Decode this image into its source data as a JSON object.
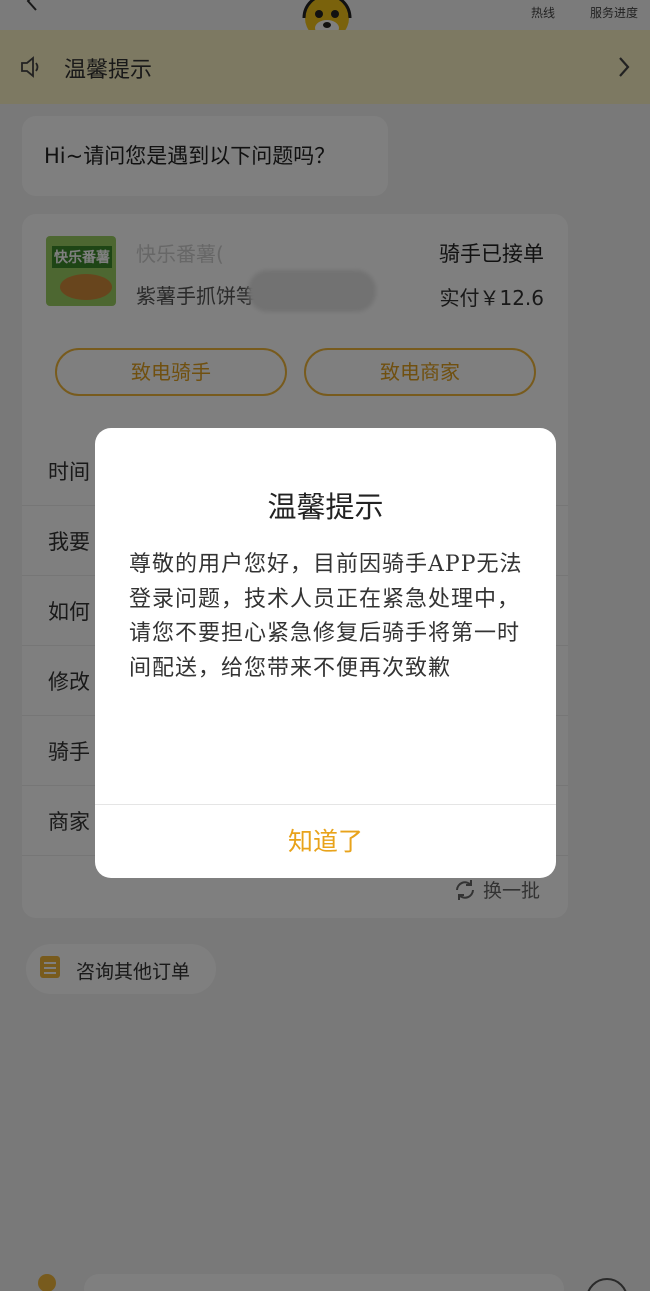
{
  "header": {
    "hotline_label": "热线",
    "progress_label": "服务进度"
  },
  "notice": {
    "text": "温馨提示"
  },
  "greeting": {
    "text": "Hi~请问您是遇到以下问题吗？"
  },
  "order": {
    "thumb_brand": "快乐番薯",
    "shop_name": "快乐番薯(",
    "item_name": "紫薯手抓饼等",
    "status": "骑手已接单",
    "price": "实付￥12.6",
    "call_rider_label": "致电骑手",
    "call_merchant_label": "致电商家"
  },
  "faq": {
    "items": [
      {
        "label": "时间"
      },
      {
        "label": "我要"
      },
      {
        "label": "如何"
      },
      {
        "label": "修改"
      },
      {
        "label": "骑手"
      },
      {
        "label": "商家"
      }
    ],
    "refresh_label": "换一批"
  },
  "other_orders": {
    "label": "咨询其他订单"
  },
  "dialog": {
    "title": "温馨提示",
    "body": "尊敬的用户您好，目前因骑手APP无法登录问题，技术人员正在紧急处理中，请您不要担心紧急修复后骑手将第一时间配送，给您带来不便再次致歉",
    "ok_label": "知道了"
  },
  "colors": {
    "accent": "#e8a31b",
    "notice_bg": "#fbf2c4"
  }
}
